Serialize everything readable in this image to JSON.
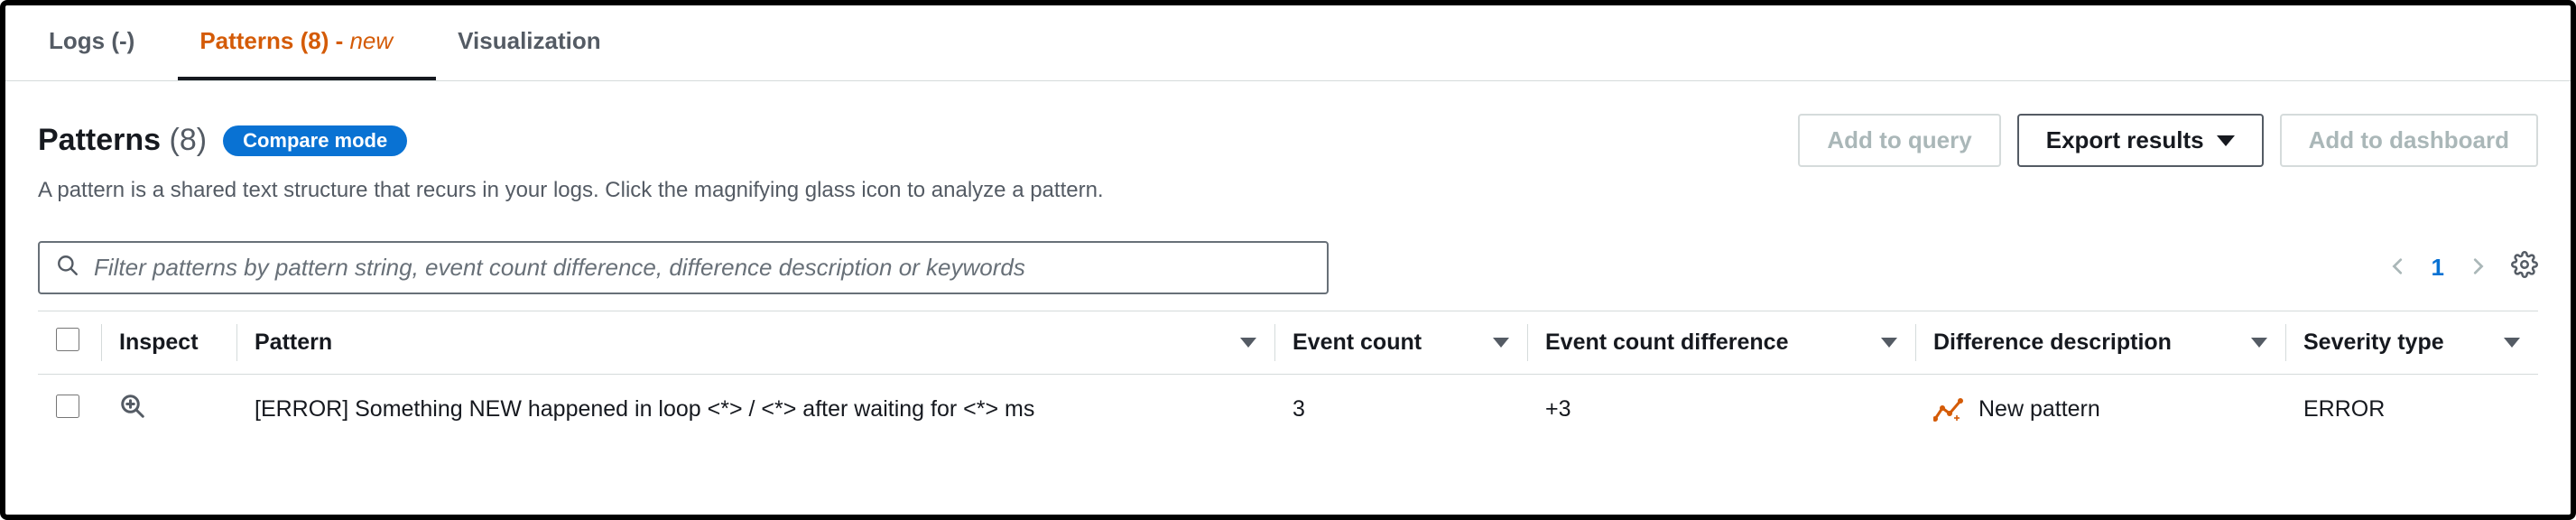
{
  "tabs": {
    "logs": "Logs (-)",
    "patterns": "Patterns (8) - ",
    "patterns_new": "new",
    "visualization": "Visualization"
  },
  "header": {
    "title": "Patterns",
    "count": "(8)",
    "compare": "Compare mode",
    "add_to_query": "Add to query",
    "export_results": "Export results",
    "add_to_dashboard": "Add to dashboard"
  },
  "description": "A pattern is a shared text structure that recurs in your logs. Click the magnifying glass icon to analyze a pattern.",
  "filter": {
    "placeholder": "Filter patterns by pattern string, event count difference, difference description or keywords"
  },
  "pager": {
    "page": "1"
  },
  "table": {
    "columns": {
      "inspect": "Inspect",
      "pattern": "Pattern",
      "event_count": "Event count",
      "event_count_diff": "Event count difference",
      "diff_desc": "Difference description",
      "severity": "Severity type"
    },
    "rows": [
      {
        "pattern": "[ERROR] Something NEW happened in loop <*> / <*> after waiting for <*> ms",
        "event_count": "3",
        "event_count_diff": "+3",
        "diff_desc": "New pattern",
        "severity": "ERROR"
      }
    ]
  }
}
